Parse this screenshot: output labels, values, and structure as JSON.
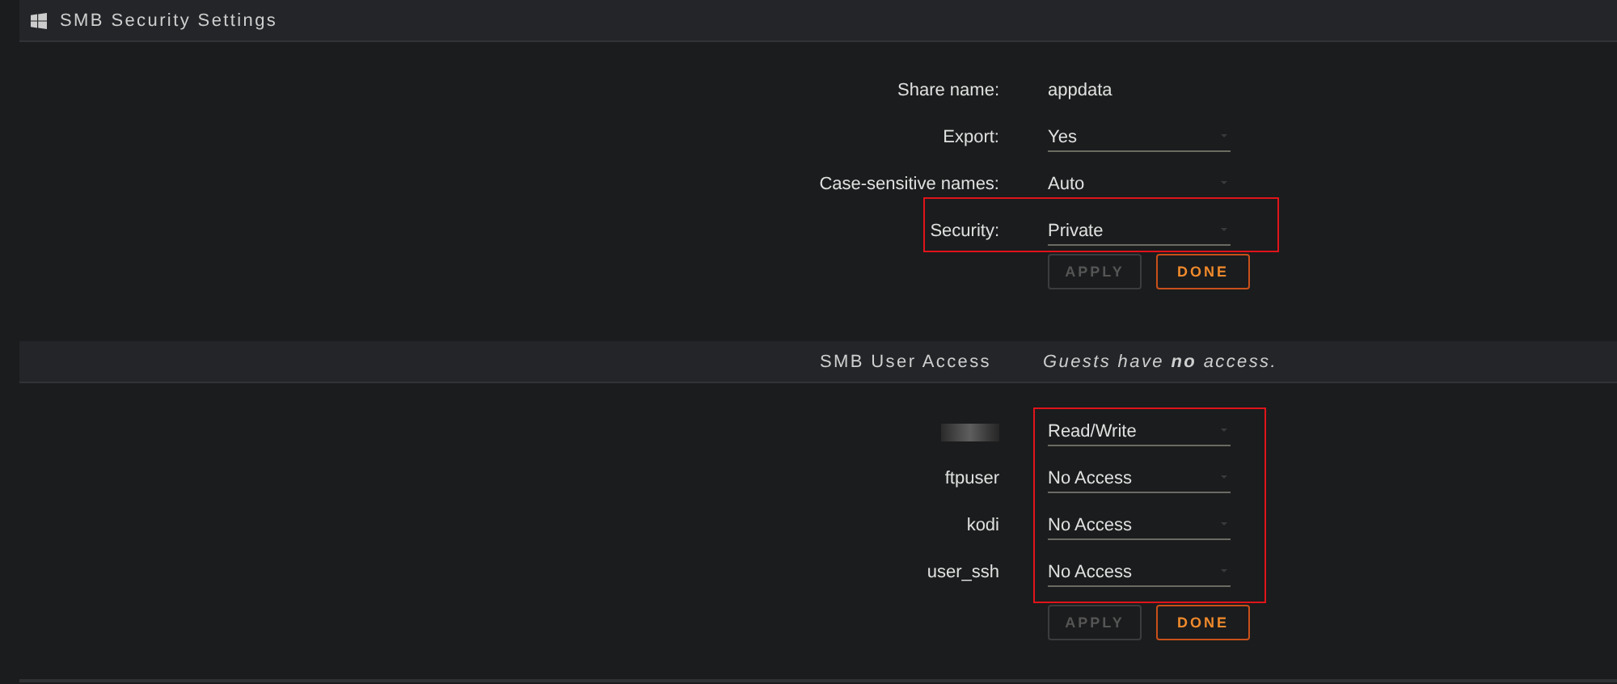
{
  "header": {
    "title": "SMB Security Settings"
  },
  "settings": [
    {
      "label": "Share name:",
      "value": "appdata",
      "kind": "text",
      "highlighted": false
    },
    {
      "label": "Export:",
      "value": "Yes",
      "kind": "select",
      "highlighted": false
    },
    {
      "label": "Case-sensitive names:",
      "value": "Auto",
      "kind": "select",
      "highlighted": false
    },
    {
      "label": "Security:",
      "value": "Private",
      "kind": "select",
      "highlighted": true
    }
  ],
  "settings_buttons": [
    {
      "label": "APPLY",
      "disabled": true
    },
    {
      "label": "DONE",
      "disabled": false
    }
  ],
  "user_access": {
    "title": "SMB User Access",
    "note": "Guests have **no** access.",
    "highlighted": true,
    "users": [
      {
        "redacted": true,
        "value": "Read/Write"
      },
      {
        "name": "ftpuser",
        "redacted": false,
        "value": "No Access"
      },
      {
        "name": "kodi",
        "redacted": false,
        "value": "No Access"
      },
      {
        "name": "user_ssh",
        "redacted": false,
        "value": "No Access"
      }
    ]
  },
  "access_buttons": [
    {
      "label": "APPLY",
      "disabled": true
    },
    {
      "label": "DONE",
      "disabled": false
    }
  ]
}
